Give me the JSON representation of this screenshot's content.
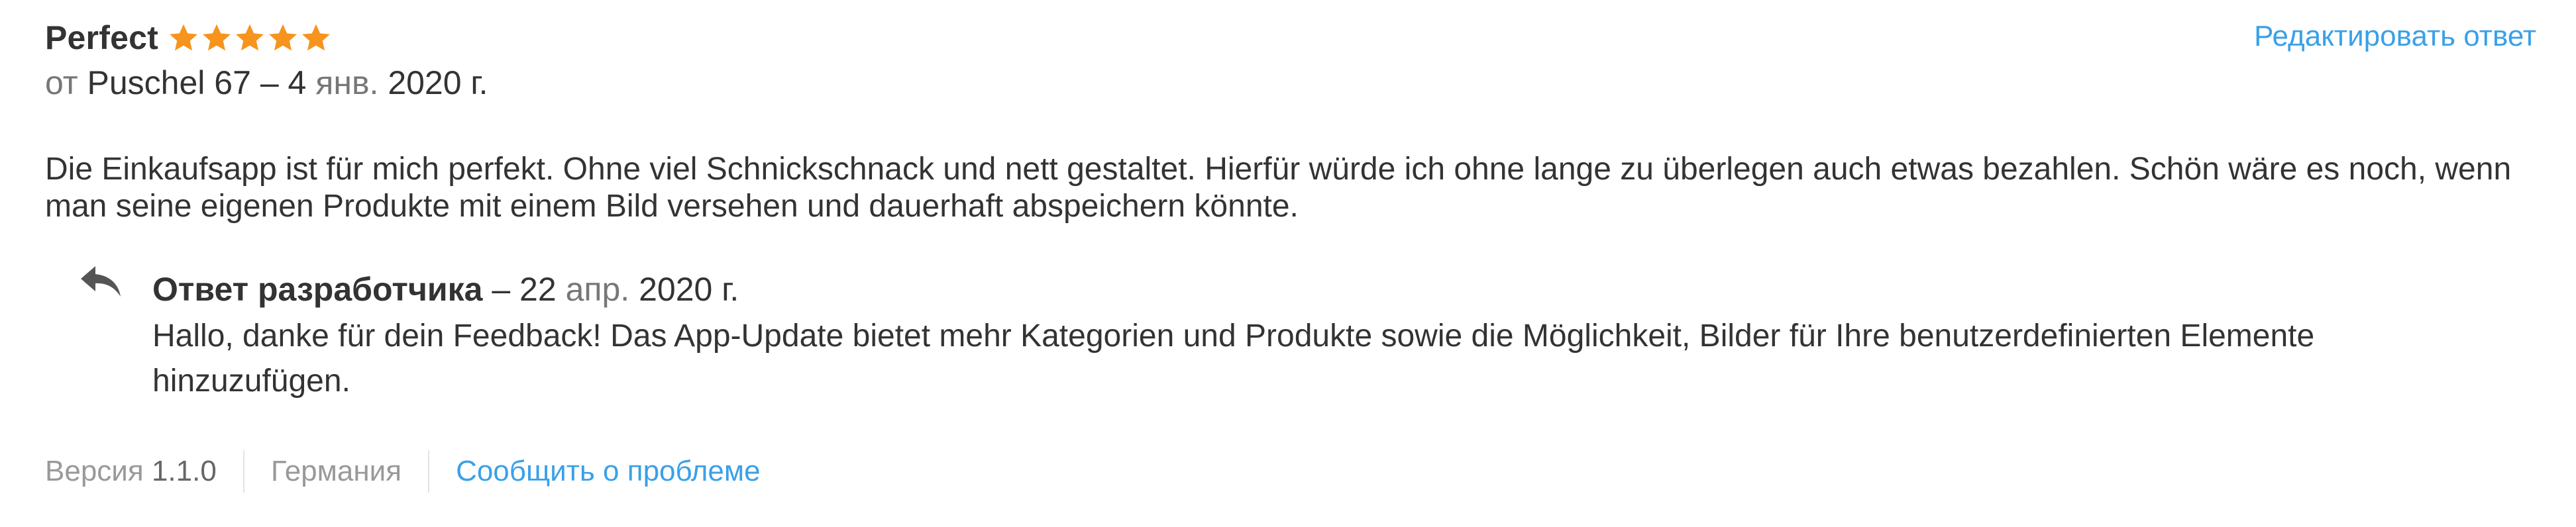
{
  "review": {
    "title": "Perfect",
    "rating": 5,
    "rating_max": 5,
    "edit_link": "Редактировать ответ",
    "byline_prefix": "от",
    "author": "Puschel 67",
    "byline_sep": "–",
    "date_day": "4",
    "date_month": "янв.",
    "date_year": "2020 г.",
    "text": "Die Einkaufsapp ist für mich perfekt. Ohne viel Schnickschnack und nett gestaltet. Hierfür würde ich ohne lange zu überlegen auch etwas bezahlen. Schön wäre es noch, wenn man seine eigenen Produkte mit einem Bild versehen und dauerhaft abspeichern könnte."
  },
  "developer_response": {
    "label": "Ответ разработчика",
    "sep": "–",
    "date_day": "22",
    "date_month": "апр.",
    "date_year": "2020 г.",
    "text": "Hallo, danke für dein Feedback! Das App-Update bietet mehr Kategorien und Produkte sowie die Möglichkeit, Bilder für Ihre benutzerdefinierten Elemente hinzuzufügen."
  },
  "footer": {
    "version_label": "Версия",
    "version_value": "1.1.0",
    "country": "Германия",
    "report_link": "Сообщить о проблеме"
  },
  "colors": {
    "star": "#f7941d",
    "link": "#3aa0e8",
    "text": "#333333",
    "muted": "#777777"
  },
  "icons": {
    "star": "star-icon",
    "reply": "reply-arrow-icon"
  }
}
